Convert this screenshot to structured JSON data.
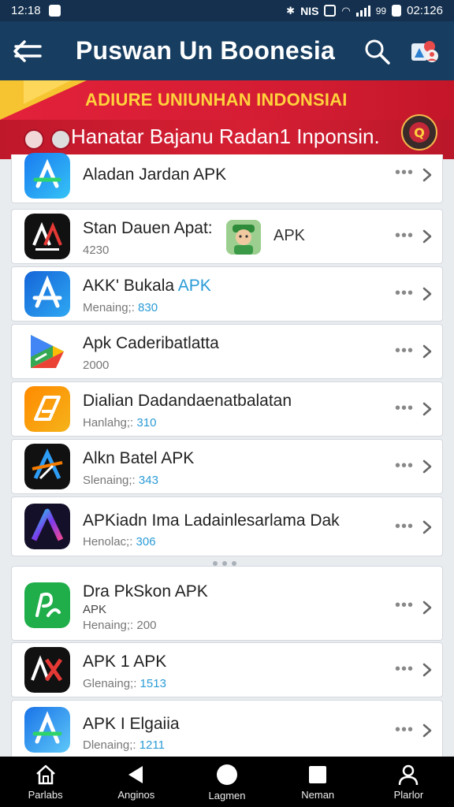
{
  "status_bar": {
    "time": "12:18",
    "clock_right": "02:126",
    "carrier": "NIS",
    "percent": "99"
  },
  "header": {
    "title": "Puswan Un Boonesia"
  },
  "banner": {
    "title": "ADIURE UNIUNHAN INDONSIAI",
    "subtitle": "Hanatar Bajanu Radan1 Inponsin."
  },
  "apps": [
    {
      "name": "Aladan Jardan APK",
      "meta_label": "",
      "meta_value": ""
    },
    {
      "name": "Stan Dauen Apat:",
      "extra": "APK",
      "meta_label": "4230",
      "meta_value": ""
    },
    {
      "name": "AKK' Bukala",
      "name_tag": "APK",
      "meta_label": "Menaing;: ",
      "meta_value": "830"
    },
    {
      "name": "Apk Caderibatlatta",
      "meta_label": "2000",
      "meta_value": ""
    },
    {
      "name": "Dialian Dadandaenatbalatan",
      "meta_label": "Hanlahg;: ",
      "meta_value": "310"
    },
    {
      "name": "Alkn Batel APK",
      "meta_label": "Slenaing;: ",
      "meta_value": "343"
    },
    {
      "name": "APKiadn Ima Ladainlesarlama Dak",
      "meta_label": "Henolac;: ",
      "meta_value": "306"
    },
    {
      "name": "Dra PkSkon APK",
      "sub": "APK",
      "meta_label": "Henaing;: ",
      "meta_value": "200"
    },
    {
      "name": "APK 1 APK",
      "meta_label": "Glenaing;: ",
      "meta_value": "1513"
    },
    {
      "name": "APK I Elgaiia",
      "meta_label": "Dlenaing;: ",
      "meta_value": "1211"
    }
  ],
  "nav": [
    {
      "label": "Parlabs",
      "icon": "home-icon"
    },
    {
      "label": "Anginos",
      "icon": "back-triangle-icon"
    },
    {
      "label": "Lagmen",
      "icon": "circle-home-icon"
    },
    {
      "label": "Neman",
      "icon": "square-recents-icon"
    },
    {
      "label": "Plarlor",
      "icon": "person-icon"
    }
  ],
  "colors": {
    "appbar": "#173d60",
    "banner": "#d61f33",
    "banner_title": "#ffd23c",
    "link": "#2a9bd6"
  }
}
